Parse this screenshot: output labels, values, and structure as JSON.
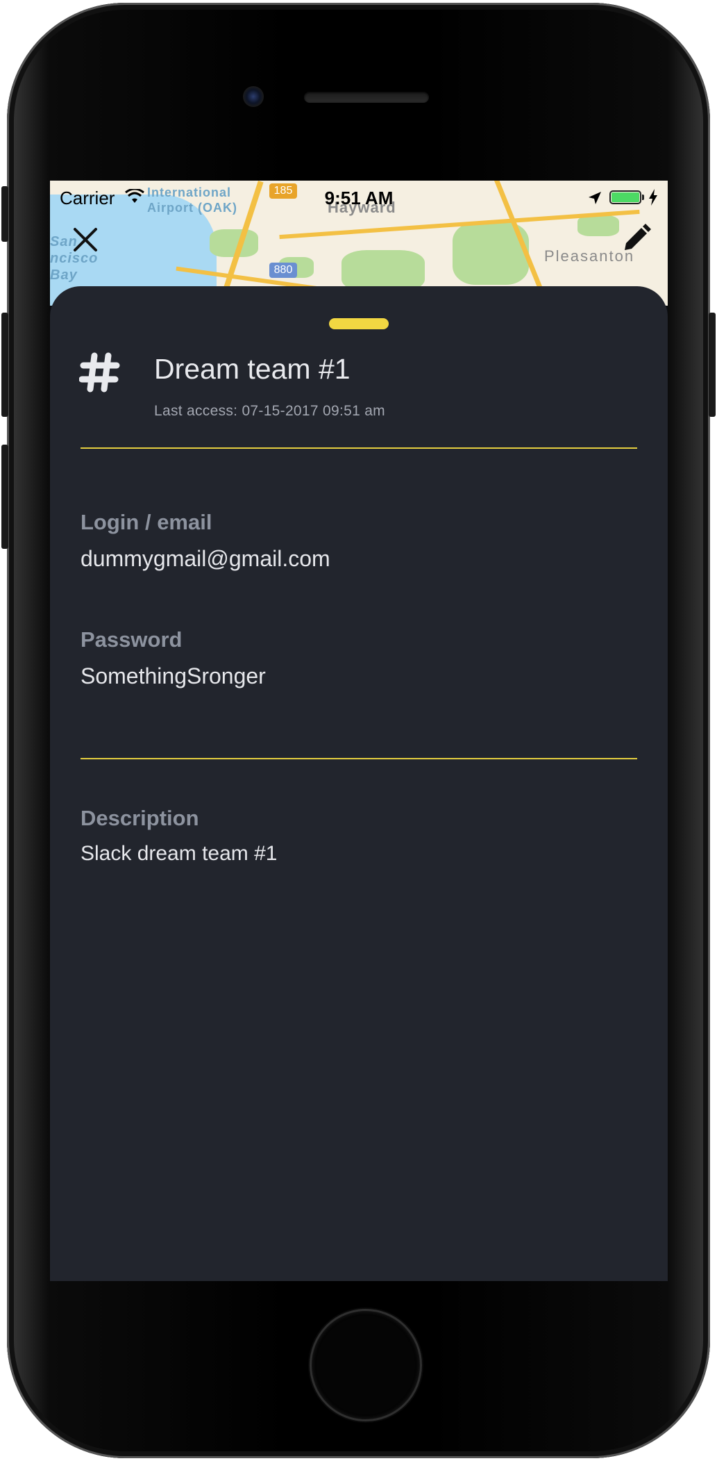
{
  "status_bar": {
    "carrier": "Carrier",
    "time": "9:51 AM"
  },
  "map": {
    "places": [
      "Oakland International Airport (OAK)",
      "Hayward",
      "San Francisco Bay",
      "Pleasanton"
    ],
    "highways": [
      "185",
      "880"
    ]
  },
  "nav": {
    "close_icon": "close-icon",
    "edit_icon": "pencil-icon"
  },
  "header": {
    "icon": "hash-icon",
    "title": "Dream team #1",
    "last_access": "Last access: 07-15-2017 09:51 am"
  },
  "fields": {
    "login_label": "Login / email",
    "login_value": "dummygmail@gmail.com",
    "password_label": "Password",
    "password_value": "SomethingSronger",
    "description_label": "Description",
    "description_value": "Slack dream team #1"
  },
  "colors": {
    "accent": "#f2d742",
    "sheet_background": "#22252d",
    "label": "#8d939f",
    "battery": "#4cd964"
  }
}
